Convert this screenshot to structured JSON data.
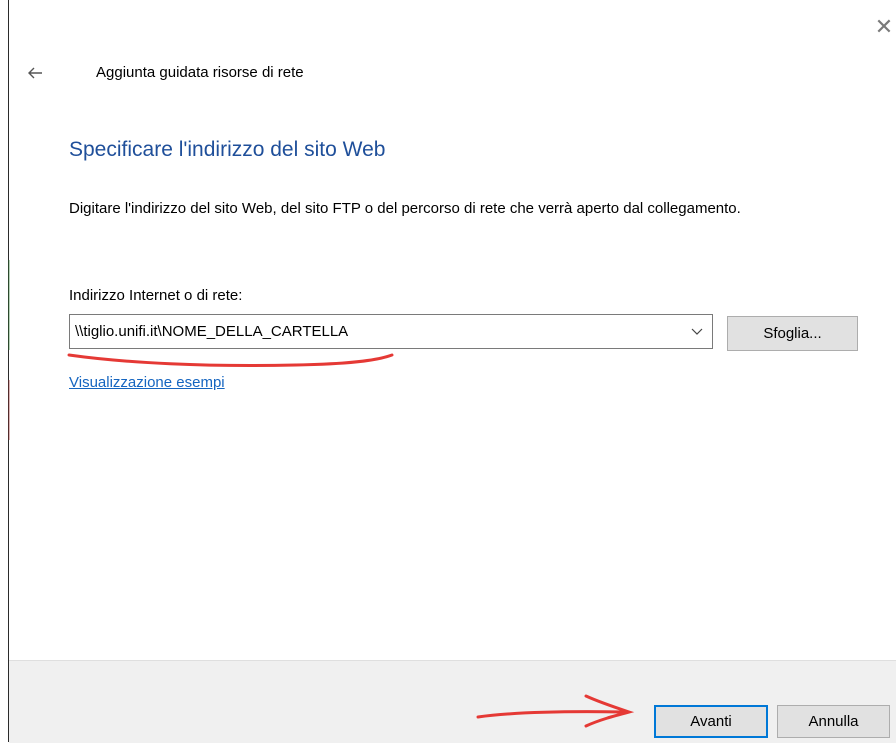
{
  "window": {
    "title": "Aggiunta guidata risorse di rete",
    "close_icon": "close-icon",
    "back_icon": "back-arrow-icon"
  },
  "page": {
    "heading": "Specificare l'indirizzo del sito Web",
    "description": "Digitare l'indirizzo del sito Web, del sito FTP o del percorso di rete che verrà aperto dal collegamento.",
    "field_label": "Indirizzo Internet o di rete:",
    "address_value": "\\\\tiglio.unifi.it\\NOME_DELLA_CARTELLA",
    "browse_label": "Sfoglia...",
    "examples_link": "Visualizzazione esempi"
  },
  "footer": {
    "next_label": "Avanti",
    "cancel_label": "Annulla"
  },
  "colors": {
    "heading": "#1f4f9a",
    "link": "#1565c0",
    "annotation": "#e53935",
    "default_button_border": "#0078d7"
  }
}
